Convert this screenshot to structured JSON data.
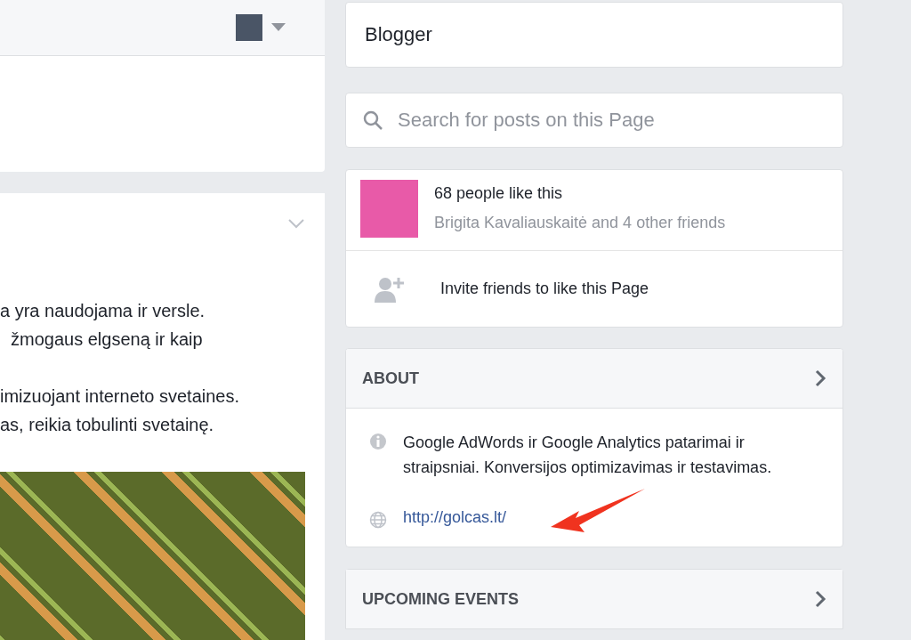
{
  "post_column": {
    "paragraphs": [
      [
        "a yra naudojama ir versle.",
        "žmogaus elgseną ir kaip"
      ],
      [
        "imizuojant interneto svetaines.",
        "as, reikia tobulinti svetainę."
      ]
    ]
  },
  "page_title": "Blogger",
  "search": {
    "placeholder": "Search for posts on this Page"
  },
  "likes": {
    "count_text": "68 people like this",
    "friends_text": "Brigita Kavaliauskaitė and 4 other friends",
    "invite_text": "Invite friends to like this Page"
  },
  "about": {
    "heading": "ABOUT",
    "description": "Google AdWords ir Google Analytics patarimai ir straipsniai. Konversijos optimizavimas ir testavimas.",
    "website": "http://golcas.lt/"
  },
  "upcoming_events": {
    "heading": "UPCOMING EVENTS"
  }
}
